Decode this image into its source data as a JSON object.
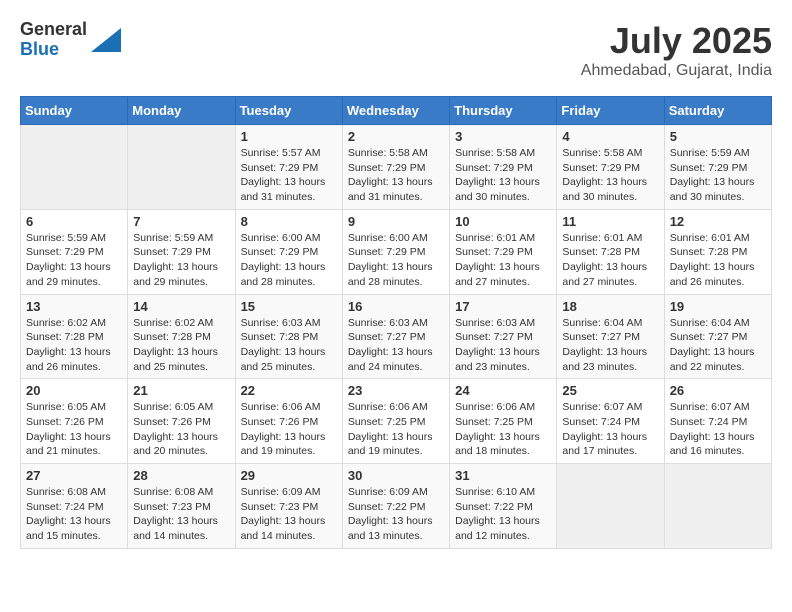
{
  "logo": {
    "general": "General",
    "blue": "Blue"
  },
  "title": {
    "month_year": "July 2025",
    "location": "Ahmedabad, Gujarat, India"
  },
  "headers": [
    "Sunday",
    "Monday",
    "Tuesday",
    "Wednesday",
    "Thursday",
    "Friday",
    "Saturday"
  ],
  "weeks": [
    [
      {
        "day": "",
        "info": ""
      },
      {
        "day": "",
        "info": ""
      },
      {
        "day": "1",
        "info": "Sunrise: 5:57 AM\nSunset: 7:29 PM\nDaylight: 13 hours and 31 minutes."
      },
      {
        "day": "2",
        "info": "Sunrise: 5:58 AM\nSunset: 7:29 PM\nDaylight: 13 hours and 31 minutes."
      },
      {
        "day": "3",
        "info": "Sunrise: 5:58 AM\nSunset: 7:29 PM\nDaylight: 13 hours and 30 minutes."
      },
      {
        "day": "4",
        "info": "Sunrise: 5:58 AM\nSunset: 7:29 PM\nDaylight: 13 hours and 30 minutes."
      },
      {
        "day": "5",
        "info": "Sunrise: 5:59 AM\nSunset: 7:29 PM\nDaylight: 13 hours and 30 minutes."
      }
    ],
    [
      {
        "day": "6",
        "info": "Sunrise: 5:59 AM\nSunset: 7:29 PM\nDaylight: 13 hours and 29 minutes."
      },
      {
        "day": "7",
        "info": "Sunrise: 5:59 AM\nSunset: 7:29 PM\nDaylight: 13 hours and 29 minutes."
      },
      {
        "day": "8",
        "info": "Sunrise: 6:00 AM\nSunset: 7:29 PM\nDaylight: 13 hours and 28 minutes."
      },
      {
        "day": "9",
        "info": "Sunrise: 6:00 AM\nSunset: 7:29 PM\nDaylight: 13 hours and 28 minutes."
      },
      {
        "day": "10",
        "info": "Sunrise: 6:01 AM\nSunset: 7:29 PM\nDaylight: 13 hours and 27 minutes."
      },
      {
        "day": "11",
        "info": "Sunrise: 6:01 AM\nSunset: 7:28 PM\nDaylight: 13 hours and 27 minutes."
      },
      {
        "day": "12",
        "info": "Sunrise: 6:01 AM\nSunset: 7:28 PM\nDaylight: 13 hours and 26 minutes."
      }
    ],
    [
      {
        "day": "13",
        "info": "Sunrise: 6:02 AM\nSunset: 7:28 PM\nDaylight: 13 hours and 26 minutes."
      },
      {
        "day": "14",
        "info": "Sunrise: 6:02 AM\nSunset: 7:28 PM\nDaylight: 13 hours and 25 minutes."
      },
      {
        "day": "15",
        "info": "Sunrise: 6:03 AM\nSunset: 7:28 PM\nDaylight: 13 hours and 25 minutes."
      },
      {
        "day": "16",
        "info": "Sunrise: 6:03 AM\nSunset: 7:27 PM\nDaylight: 13 hours and 24 minutes."
      },
      {
        "day": "17",
        "info": "Sunrise: 6:03 AM\nSunset: 7:27 PM\nDaylight: 13 hours and 23 minutes."
      },
      {
        "day": "18",
        "info": "Sunrise: 6:04 AM\nSunset: 7:27 PM\nDaylight: 13 hours and 23 minutes."
      },
      {
        "day": "19",
        "info": "Sunrise: 6:04 AM\nSunset: 7:27 PM\nDaylight: 13 hours and 22 minutes."
      }
    ],
    [
      {
        "day": "20",
        "info": "Sunrise: 6:05 AM\nSunset: 7:26 PM\nDaylight: 13 hours and 21 minutes."
      },
      {
        "day": "21",
        "info": "Sunrise: 6:05 AM\nSunset: 7:26 PM\nDaylight: 13 hours and 20 minutes."
      },
      {
        "day": "22",
        "info": "Sunrise: 6:06 AM\nSunset: 7:26 PM\nDaylight: 13 hours and 19 minutes."
      },
      {
        "day": "23",
        "info": "Sunrise: 6:06 AM\nSunset: 7:25 PM\nDaylight: 13 hours and 19 minutes."
      },
      {
        "day": "24",
        "info": "Sunrise: 6:06 AM\nSunset: 7:25 PM\nDaylight: 13 hours and 18 minutes."
      },
      {
        "day": "25",
        "info": "Sunrise: 6:07 AM\nSunset: 7:24 PM\nDaylight: 13 hours and 17 minutes."
      },
      {
        "day": "26",
        "info": "Sunrise: 6:07 AM\nSunset: 7:24 PM\nDaylight: 13 hours and 16 minutes."
      }
    ],
    [
      {
        "day": "27",
        "info": "Sunrise: 6:08 AM\nSunset: 7:24 PM\nDaylight: 13 hours and 15 minutes."
      },
      {
        "day": "28",
        "info": "Sunrise: 6:08 AM\nSunset: 7:23 PM\nDaylight: 13 hours and 14 minutes."
      },
      {
        "day": "29",
        "info": "Sunrise: 6:09 AM\nSunset: 7:23 PM\nDaylight: 13 hours and 14 minutes."
      },
      {
        "day": "30",
        "info": "Sunrise: 6:09 AM\nSunset: 7:22 PM\nDaylight: 13 hours and 13 minutes."
      },
      {
        "day": "31",
        "info": "Sunrise: 6:10 AM\nSunset: 7:22 PM\nDaylight: 13 hours and 12 minutes."
      },
      {
        "day": "",
        "info": ""
      },
      {
        "day": "",
        "info": ""
      }
    ]
  ]
}
